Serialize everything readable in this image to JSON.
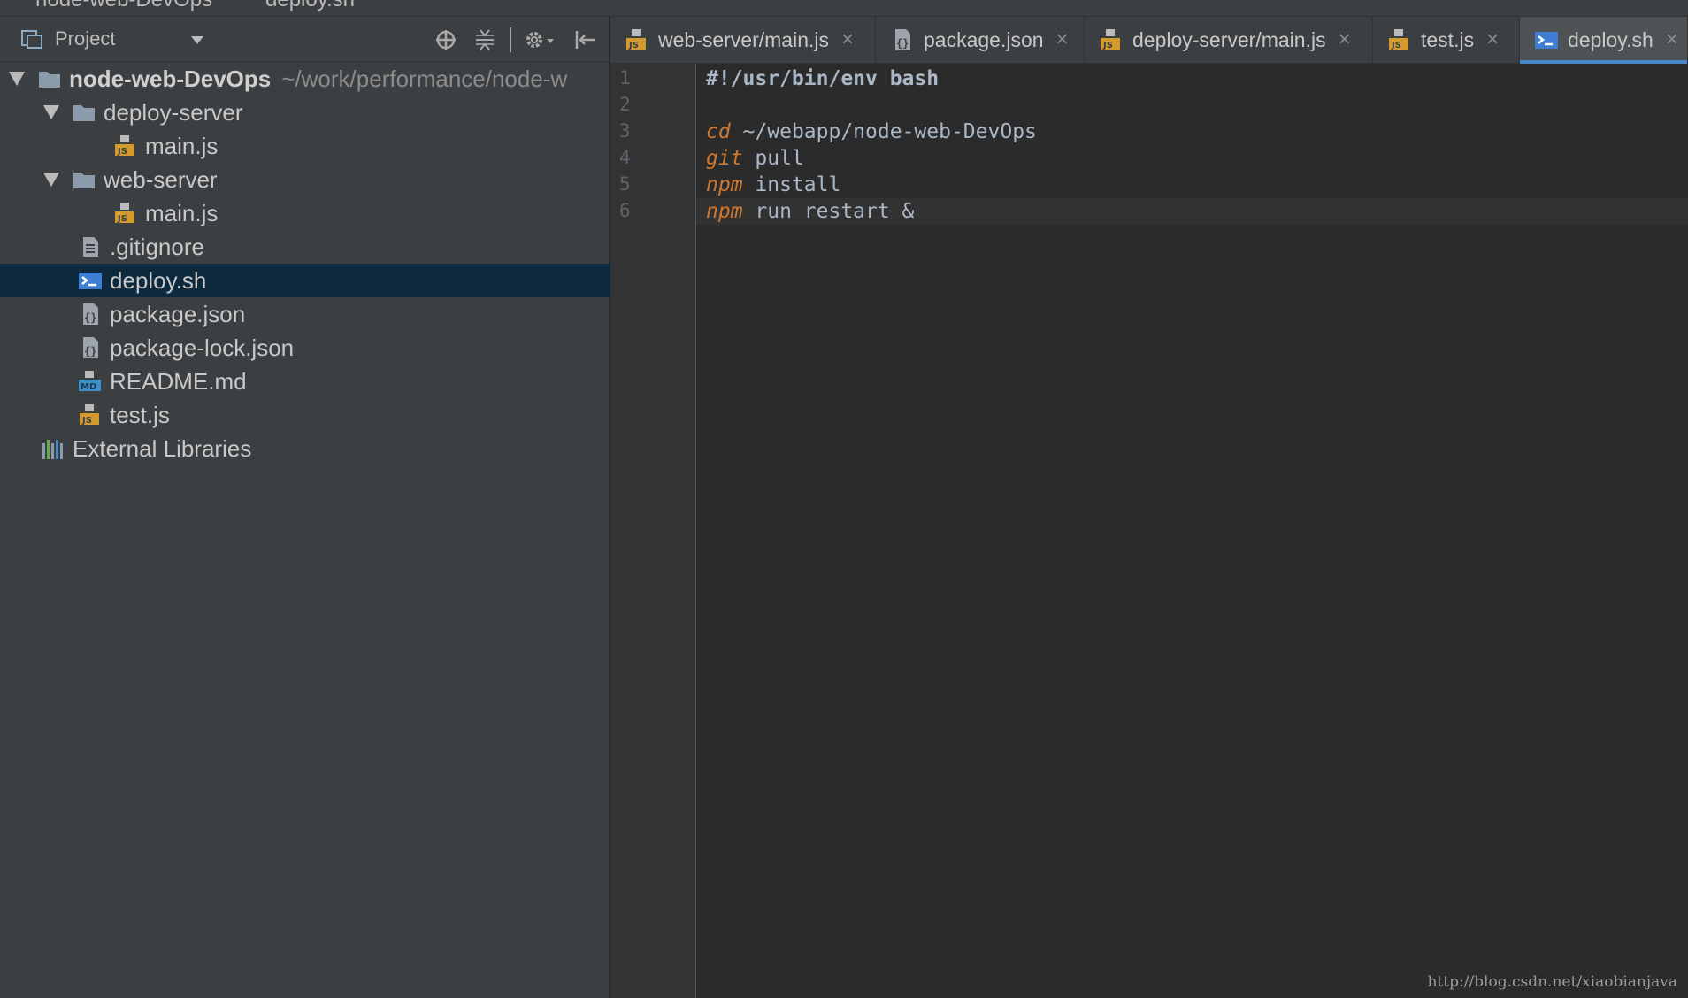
{
  "breadcrumb": {
    "items": [
      "node-web-DevOps",
      "deploy.sh"
    ]
  },
  "project_panel": {
    "title": "Project",
    "toolbar_icons": [
      "locate-icon",
      "collapse-icon",
      "gear-icon",
      "hide-icon"
    ],
    "tree": [
      {
        "name": "node-web-DevOps",
        "path": "~/work/performance/node-w",
        "icon": "folder-icon",
        "expanded": true,
        "bold": true
      },
      {
        "name": "deploy-server",
        "icon": "folder-icon",
        "expanded": true
      },
      {
        "name": "main.js",
        "icon": "js-file-icon"
      },
      {
        "name": "web-server",
        "icon": "folder-icon",
        "expanded": true
      },
      {
        "name": "main.js",
        "icon": "js-file-icon"
      },
      {
        "name": ".gitignore",
        "icon": "text-file-icon"
      },
      {
        "name": "deploy.sh",
        "icon": "shell-file-icon",
        "selected": true
      },
      {
        "name": "package.json",
        "icon": "json-file-icon"
      },
      {
        "name": "package-lock.json",
        "icon": "json-file-icon"
      },
      {
        "name": "README.md",
        "icon": "markdown-file-icon"
      },
      {
        "name": "test.js",
        "icon": "js-file-icon"
      },
      {
        "name": "External Libraries",
        "icon": "libraries-icon"
      }
    ]
  },
  "tabs": [
    {
      "label": "web-server/main.js",
      "icon": "js-file-icon",
      "close": "×"
    },
    {
      "label": "package.json",
      "icon": "json-file-icon",
      "close": "×"
    },
    {
      "label": "deploy-server/main.js",
      "icon": "js-file-icon",
      "close": "×"
    },
    {
      "label": "test.js",
      "icon": "js-file-icon",
      "close": "×"
    },
    {
      "label": "deploy.sh",
      "icon": "shell-file-icon",
      "close": "×",
      "active": true
    }
  ],
  "editor": {
    "line_numbers": [
      "1",
      "2",
      "3",
      "4",
      "5",
      "6"
    ],
    "lines": [
      {
        "cmd": "",
        "rest": "#!/usr/bin/env bash"
      },
      {
        "cmd": "",
        "rest": ""
      },
      {
        "cmd": "cd",
        "rest": " ~/webapp/node-web-DevOps"
      },
      {
        "cmd": "git",
        "rest": " pull"
      },
      {
        "cmd": "npm",
        "rest": " install"
      },
      {
        "cmd": "npm",
        "rest": " run restart &"
      }
    ]
  },
  "watermark": "http://blog.csdn.net/xiaobianjava",
  "colors": {
    "panel_bg": "#3c3f41",
    "editor_bg": "#2b2b2b",
    "selection_bg": "#0d293e",
    "keyword": "#cc7832",
    "active_tab_accent": "#4a88c7"
  }
}
